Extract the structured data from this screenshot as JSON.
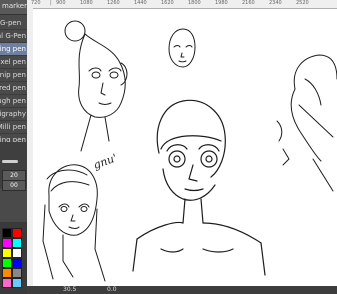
{
  "panel": {
    "title": "marker <3"
  },
  "tools": [
    {
      "label": "G-pen"
    },
    {
      "label": "al G-Pen"
    },
    {
      "label": "ping pen"
    },
    {
      "label": "ixel pen"
    },
    {
      "label": "rnip pen"
    },
    {
      "label": "ured pen"
    },
    {
      "label": "ough pen"
    },
    {
      "label": "lligraphy"
    },
    {
      "label": "Milli pen"
    },
    {
      "label": "ing pen"
    }
  ],
  "brush": {
    "size_value": "20",
    "opacity_value": "00"
  },
  "ruler": {
    "ticks": [
      "720",
      "|",
      "900",
      "1080",
      "1260",
      "1440",
      "1620",
      "1800",
      "1980",
      "2160",
      "2340",
      "2520"
    ]
  },
  "status": {
    "zoom": "30.5",
    "angle": "0.0"
  },
  "signature_text": "gnu'",
  "colors": {
    "swatches": [
      "#000000",
      "#ff0000",
      "#ff00ff",
      "#00ffff",
      "#ffff00",
      "#ffffff",
      "#00ff00",
      "#0000ff",
      "#ff8800",
      "#888888",
      "#ff66cc",
      "#66ccff"
    ]
  }
}
